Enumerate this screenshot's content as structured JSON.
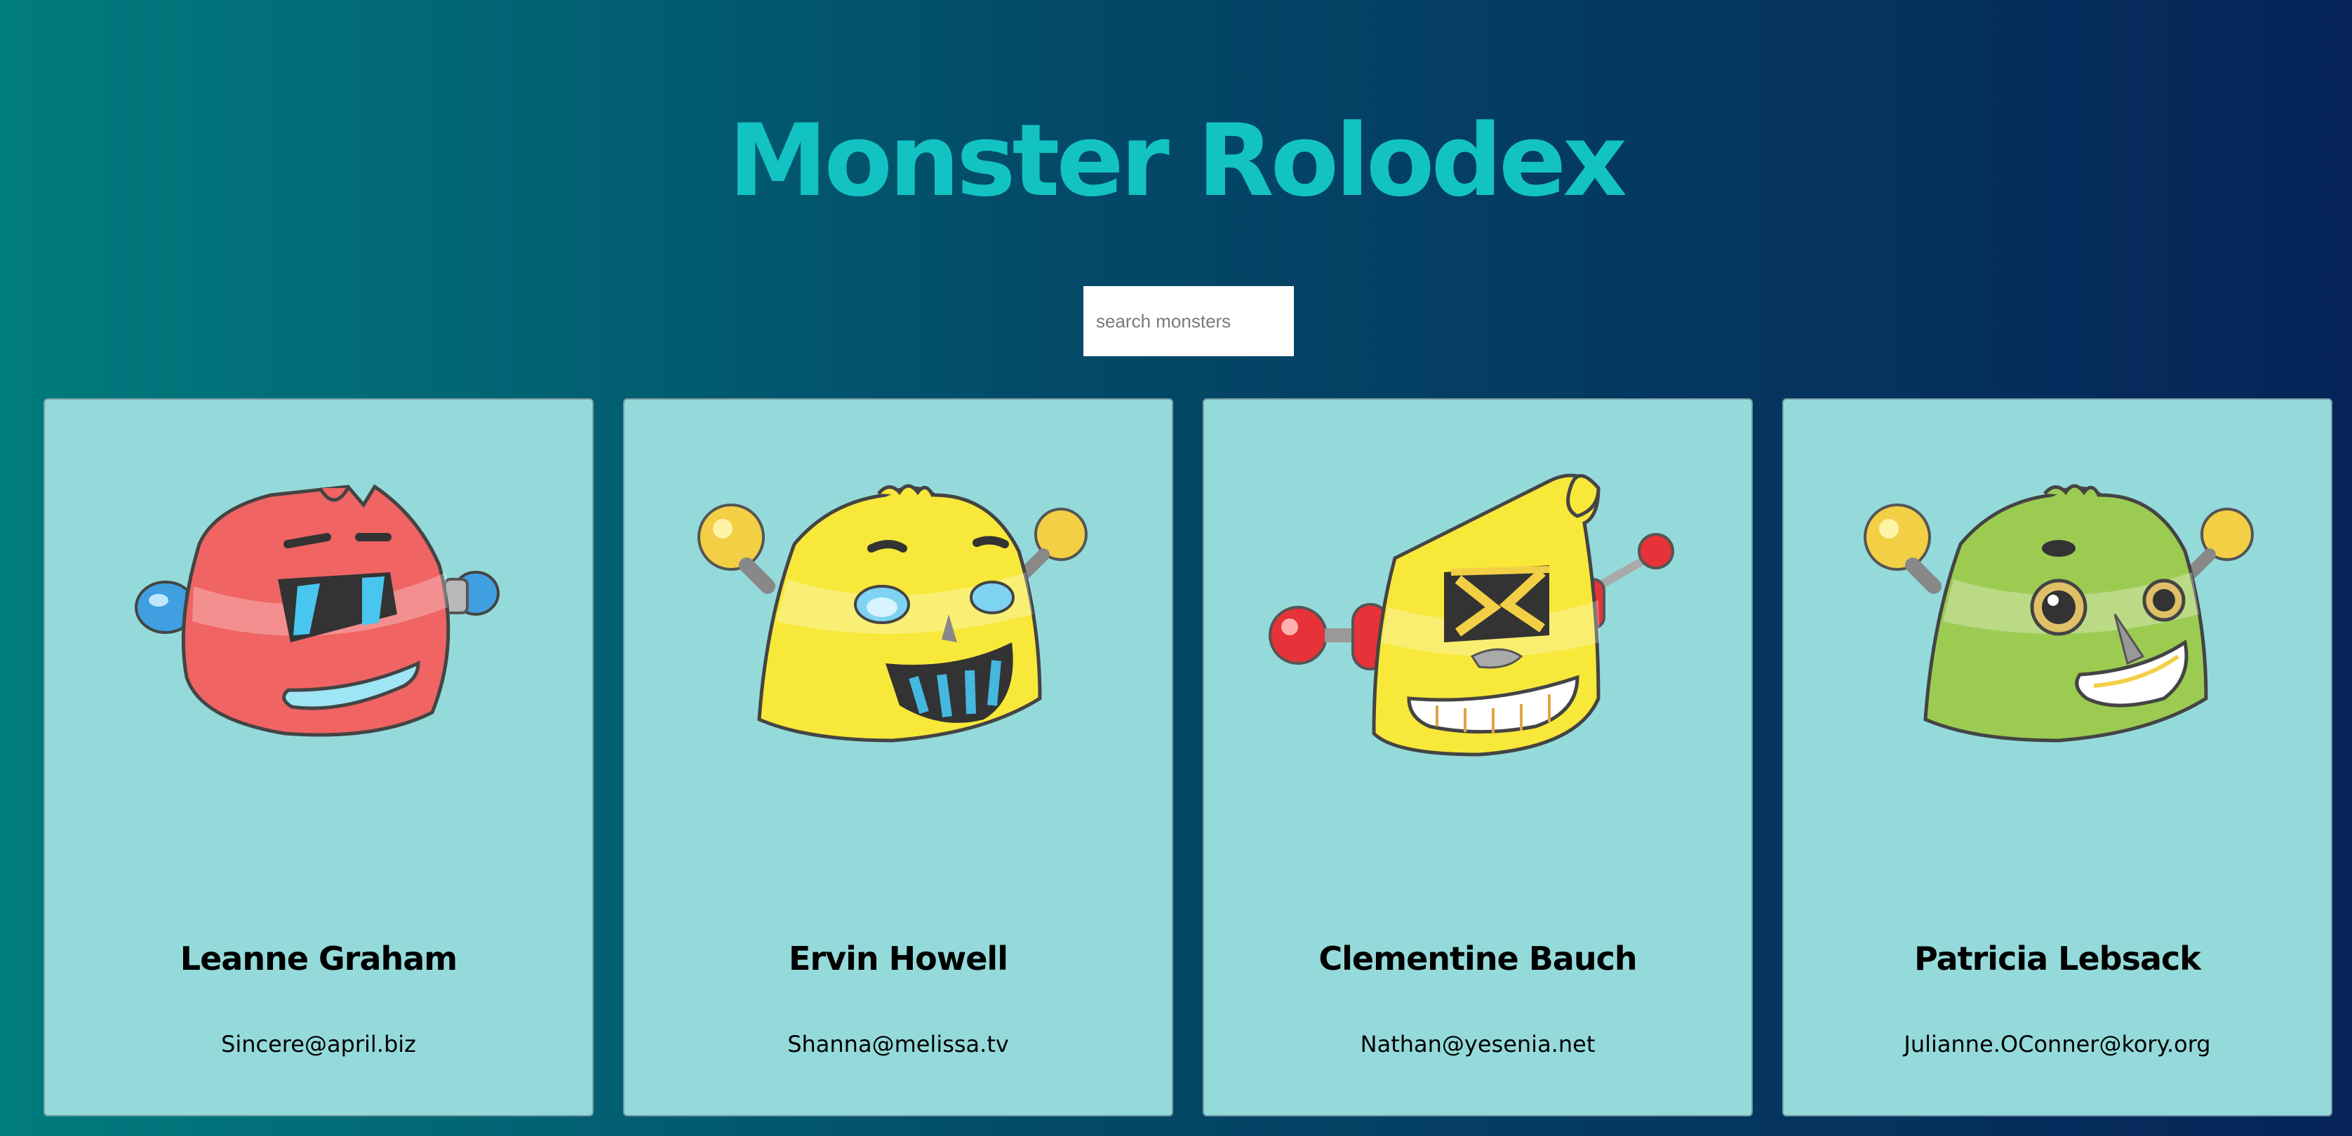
{
  "header": {
    "title": "Monster Rolodex",
    "title_color": "#13c3c3"
  },
  "search": {
    "placeholder": "search monsters",
    "value": ""
  },
  "monsters": [
    {
      "name": "Leanne Graham",
      "email": "Sincere@april.biz",
      "color": "#f06464",
      "avatar": "red-robot-monster-avatar"
    },
    {
      "name": "Ervin Howell",
      "email": "Shanna@melissa.tv",
      "color": "#f7e83a",
      "avatar": "yellow-robot-monster-avatar"
    },
    {
      "name": "Clementine Bauch",
      "email": "Nathan@yesenia.net",
      "color": "#f7e83a",
      "avatar": "yellow-robot-monster-avatar"
    },
    {
      "name": "Patricia Lebsack",
      "email": "Julianne.OConner@kory.org",
      "color": "#9ccb52",
      "avatar": "green-robot-monster-avatar"
    }
  ],
  "colors": {
    "card_background": "#95dada",
    "background_start": "#017c7e",
    "background_end": "#062458"
  }
}
